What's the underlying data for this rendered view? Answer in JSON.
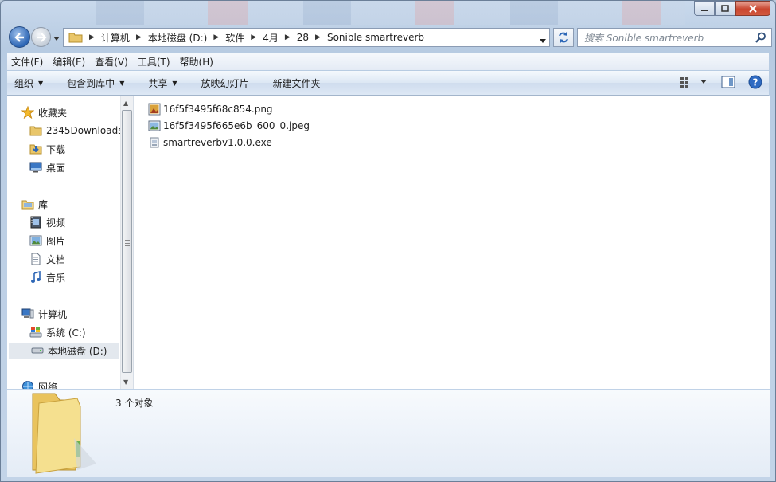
{
  "window": {
    "caption_buttons": [
      "minimize",
      "maximize",
      "close"
    ]
  },
  "address": {
    "crumbs": [
      "计算机",
      "本地磁盘 (D:)",
      "软件",
      "4月",
      "28",
      "Sonible smartreverb"
    ]
  },
  "search": {
    "placeholder": "搜索 Sonible smartreverb"
  },
  "menu": {
    "items": [
      "文件(F)",
      "编辑(E)",
      "查看(V)",
      "工具(T)",
      "帮助(H)"
    ]
  },
  "toolbar": {
    "organize": "组织",
    "include_in_library": "包含到库中",
    "share": "共享",
    "slideshow": "放映幻灯片",
    "new_folder": "新建文件夹"
  },
  "navpane": {
    "favorites": "收藏夹",
    "fav_items": [
      "2345Downloads",
      "下载",
      "桌面"
    ],
    "libraries": "库",
    "lib_items": [
      "视频",
      "图片",
      "文档",
      "音乐"
    ],
    "computer": "计算机",
    "drives": [
      "系统 (C:)",
      "本地磁盘 (D:)"
    ],
    "network": "网络"
  },
  "files": [
    {
      "name": "16f5f3495f68c854.png",
      "icon": "png-image-icon"
    },
    {
      "name": "16f5f3495f665e6b_600_0.jpeg",
      "icon": "jpeg-image-icon"
    },
    {
      "name": "smartreverbv1.0.0.exe",
      "icon": "exe-file-icon"
    }
  ],
  "details": {
    "count": "3 个对象"
  },
  "colors": {
    "frame": "#c3d4e8",
    "accent": "#2d66b5",
    "close": "#c9462f"
  }
}
